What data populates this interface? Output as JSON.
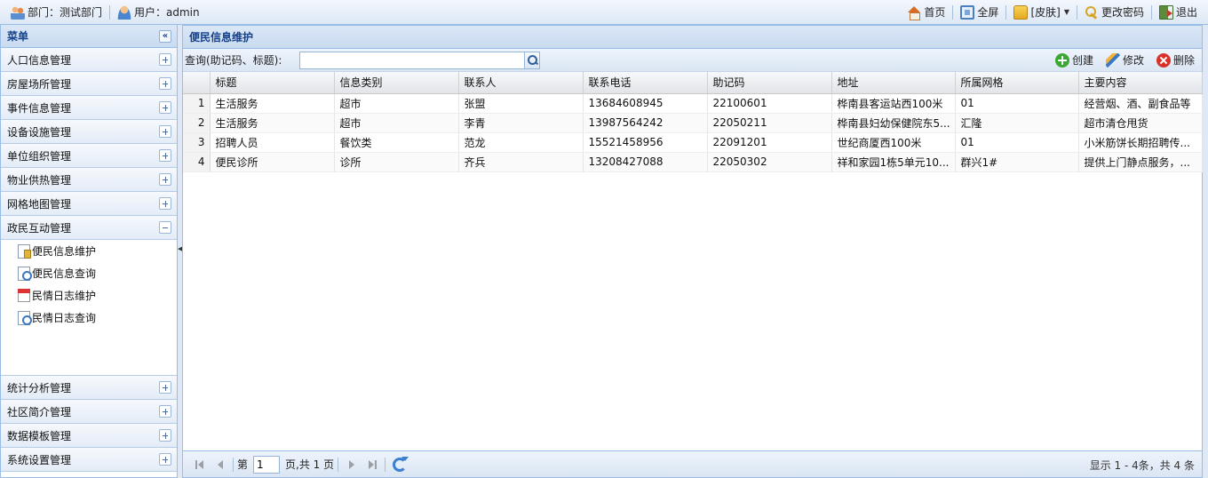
{
  "topbar": {
    "dept": "部门：测试部门",
    "user": "用户：admin",
    "home": "首页",
    "fullscreen": "全屏",
    "skin": "[皮肤]",
    "change_password": "更改密码",
    "logout": "退出"
  },
  "menu": {
    "title": "菜单",
    "groups_top": [
      "人口信息管理",
      "房屋场所管理",
      "事件信息管理",
      "设备设施管理",
      "单位组织管理",
      "物业供热管理",
      "网格地图管理"
    ],
    "expanded": {
      "label": "政民互动管理",
      "items": [
        "便民信息维护",
        "便民信息查询",
        "民情日志维护",
        "民情日志查询"
      ]
    },
    "groups_bottom": [
      "统计分析管理",
      "社区简介管理",
      "数据模板管理",
      "系统设置管理"
    ]
  },
  "panel": {
    "title": "便民信息维护",
    "query_label": "查询(助记码、标题):",
    "query_value": "",
    "create": "创建",
    "edit": "修改",
    "delete": "删除"
  },
  "grid": {
    "columns": [
      "标题",
      "信息类别",
      "联系人",
      "联系电话",
      "助记码",
      "地址",
      "所属网格",
      "主要内容"
    ],
    "rows": [
      [
        "1",
        "生活服务",
        "超市",
        "张盟",
        "13684608945",
        "22100601",
        "桦南县客运站西100米",
        "01",
        "经营烟、酒、副食品等"
      ],
      [
        "2",
        "生活服务",
        "超市",
        "李青",
        "13987564242",
        "22050211",
        "桦南县妇幼保健院东5...",
        "汇隆",
        "超市清仓甩货"
      ],
      [
        "3",
        "招聘人员",
        "餐饮类",
        "范龙",
        "15521458956",
        "22091201",
        "世纪商厦西100米",
        "01",
        "小米筋饼长期招聘传..."
      ],
      [
        "4",
        "便民诊所",
        "诊所",
        "齐兵",
        "13208427088",
        "22050302",
        "祥和家园1栋5单元10...",
        "群兴1#",
        "提供上门静点服务，..."
      ]
    ]
  },
  "pager": {
    "page_prefix": "第",
    "page_value": "1",
    "page_suffix": "页,共 1 页",
    "info": "显示 1 - 4条，共 4 条"
  }
}
